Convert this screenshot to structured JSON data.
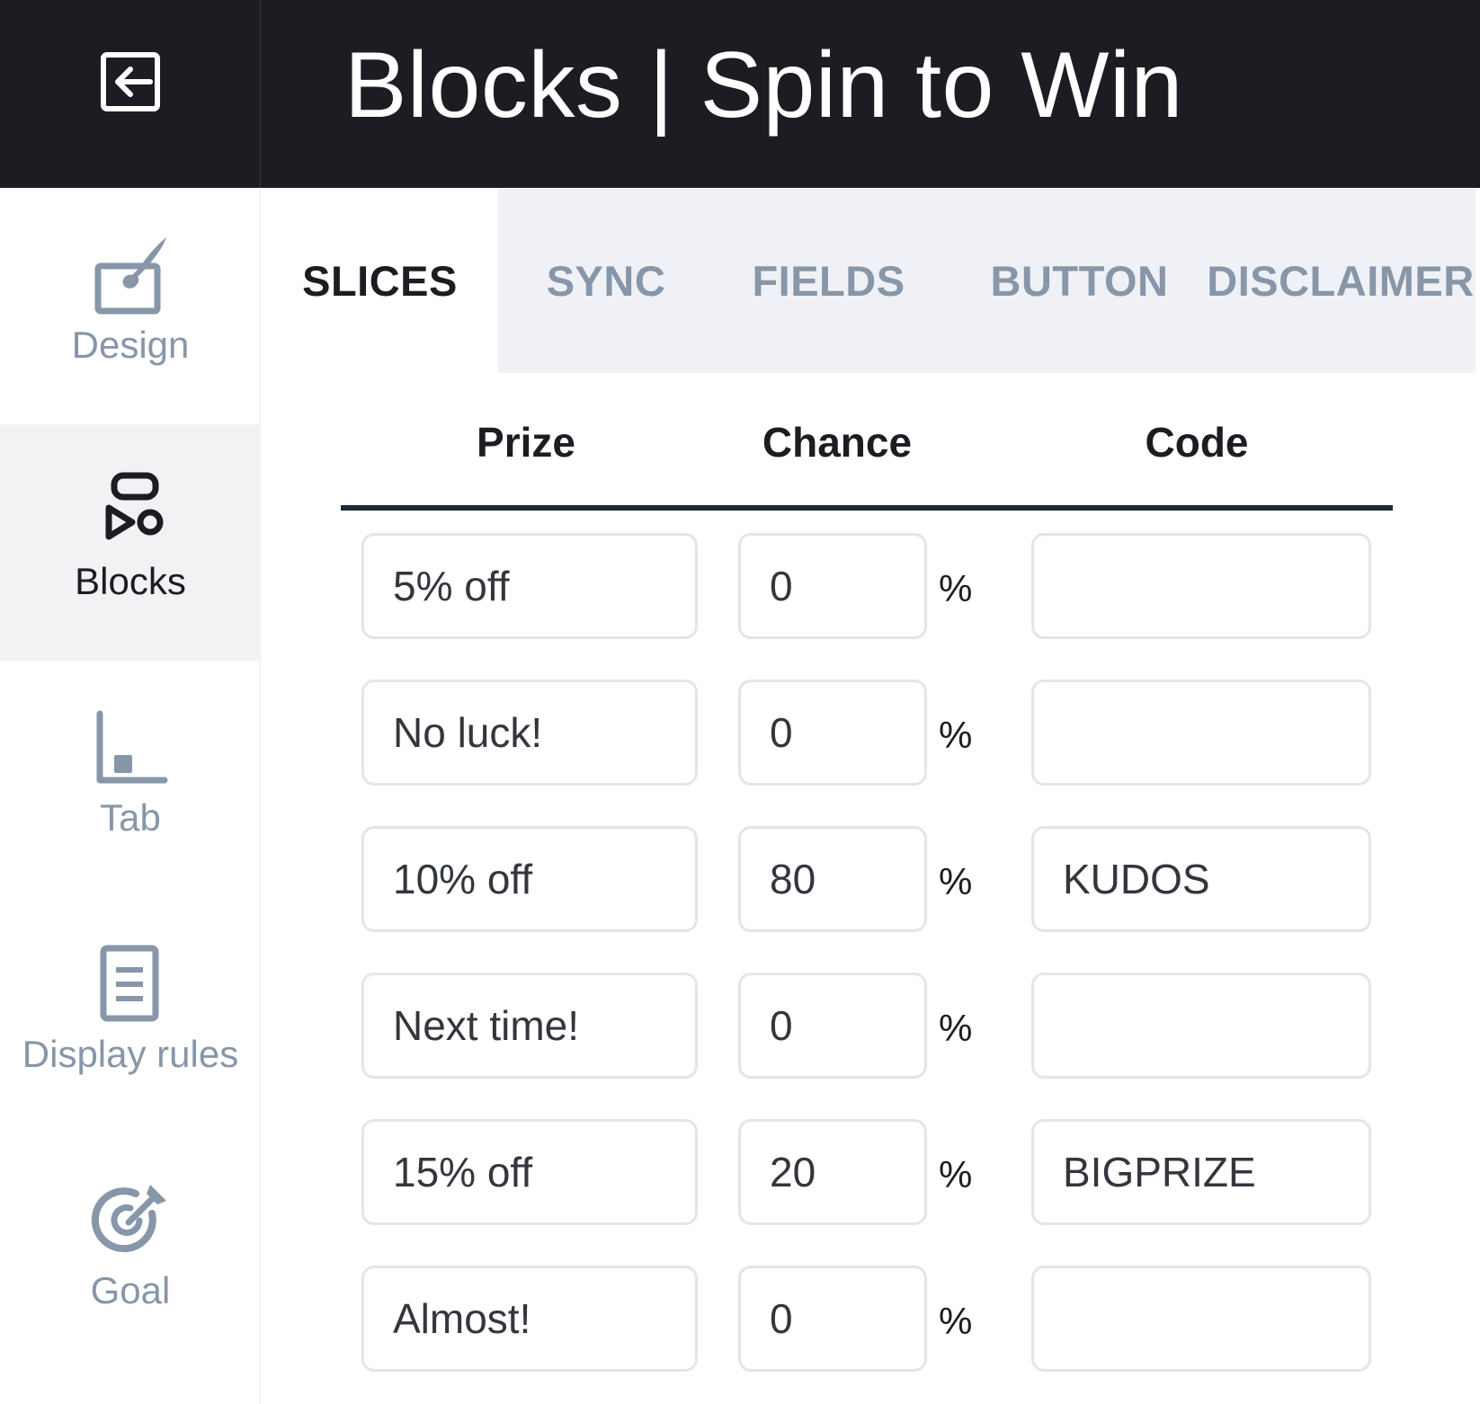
{
  "header": {
    "title": "Blocks | Spin to Win"
  },
  "sidebar": {
    "items": [
      {
        "label": "Design",
        "icon": "brush-icon"
      },
      {
        "label": "Blocks",
        "icon": "blocks-icon"
      },
      {
        "label": "Tab",
        "icon": "tab-icon"
      },
      {
        "label": "Display rules",
        "icon": "document-icon"
      },
      {
        "label": "Goal",
        "icon": "target-icon"
      }
    ],
    "active": "Blocks"
  },
  "tabs": [
    {
      "label": "SLICES"
    },
    {
      "label": "SYNC"
    },
    {
      "label": "FIELDS"
    },
    {
      "label": "BUTTON"
    },
    {
      "label": "DISCLAIMER"
    }
  ],
  "active_tab": "SLICES",
  "table": {
    "columns": [
      "Prize",
      "Chance",
      "Code"
    ],
    "percent_symbol": "%",
    "rows": [
      {
        "prize": "5% off",
        "chance": "0",
        "code": ""
      },
      {
        "prize": "No luck!",
        "chance": "0",
        "code": ""
      },
      {
        "prize": "10% off",
        "chance": "80",
        "code": "KUDOS"
      },
      {
        "prize": "Next time!",
        "chance": "0",
        "code": ""
      },
      {
        "prize": "15% off",
        "chance": "20",
        "code": "BIGPRIZE"
      },
      {
        "prize": "Almost!",
        "chance": "0",
        "code": ""
      }
    ]
  },
  "colors": {
    "header_bg": "#1d1c22",
    "tab_strip_bg": "#eff1f6",
    "muted_text": "#8796a8",
    "active_text": "#1d1c22"
  }
}
